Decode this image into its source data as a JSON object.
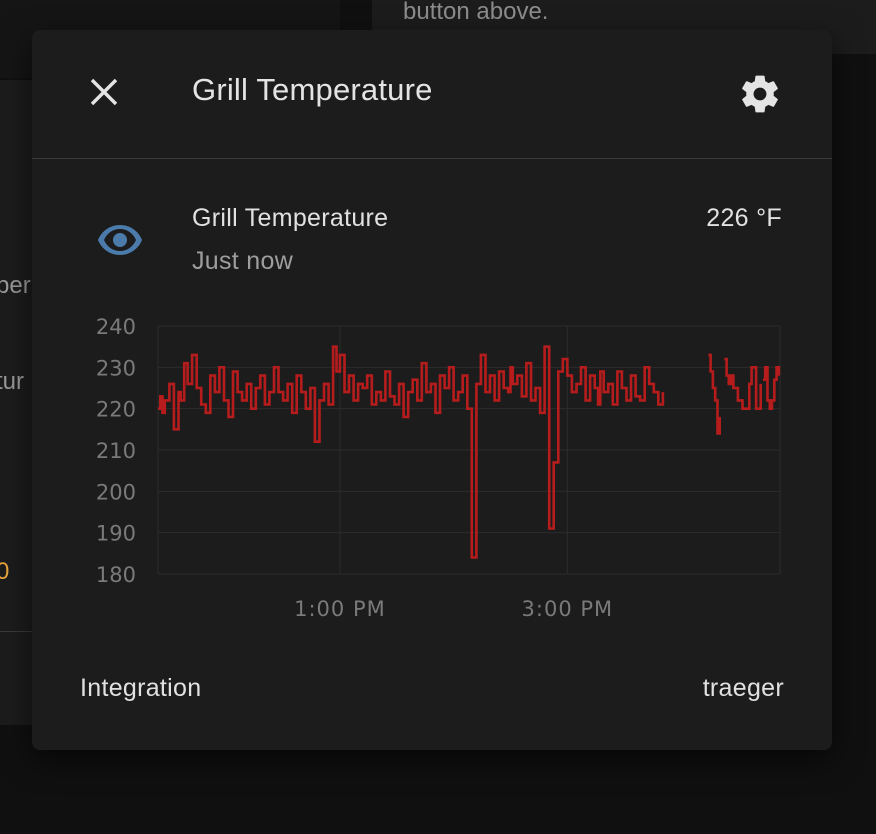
{
  "background": {
    "top_text": "button above.",
    "left_fragments": [
      "per",
      "tur",
      "0"
    ]
  },
  "dialog": {
    "title": "Grill Temperature",
    "close_icon": "close-icon",
    "settings_icon": "gear-icon"
  },
  "entity": {
    "icon": "eye-icon",
    "icon_color": "#4b7bab",
    "name": "Grill Temperature",
    "last_changed": "Just now",
    "state": "226 °F"
  },
  "attributes": {
    "integration_label": "Integration",
    "integration_value": "traeger"
  },
  "chart_data": {
    "type": "line",
    "series_color": "#b71c1c",
    "ylim": [
      180,
      240
    ],
    "y_ticks": [
      240,
      230,
      220,
      210,
      200,
      190,
      180
    ],
    "x_tick_labels": [
      "1:00 PM",
      "3:00 PM"
    ],
    "x_tick_hours": [
      13,
      15
    ],
    "xlim_hours": [
      11.4,
      16.87
    ],
    "grid": true,
    "series": [
      {
        "x_hours": [
          11.4,
          11.42,
          11.44,
          11.46,
          11.5,
          11.54,
          11.58,
          11.6,
          11.63,
          11.66,
          11.7,
          11.74,
          11.78,
          11.82,
          11.86,
          11.9,
          11.94,
          11.98,
          12.02,
          12.06,
          12.1,
          12.14,
          12.18,
          12.22,
          12.26,
          12.3,
          12.34,
          12.38,
          12.42,
          12.46,
          12.5,
          12.54,
          12.58,
          12.62,
          12.66,
          12.7,
          12.74,
          12.78,
          12.82,
          12.86,
          12.9,
          12.94,
          12.97,
          13.0,
          13.04,
          13.08,
          13.12,
          13.16,
          13.2,
          13.24,
          13.28,
          13.32,
          13.36,
          13.4,
          13.44,
          13.48,
          13.52,
          13.56,
          13.6,
          13.64,
          13.68,
          13.72,
          13.76,
          13.8,
          13.84,
          13.88,
          13.92,
          13.96,
          14.0,
          14.04,
          14.08,
          14.12,
          14.16,
          14.2,
          14.24,
          14.28,
          14.32,
          14.36,
          14.4,
          14.44,
          14.48,
          14.5,
          14.52,
          14.56,
          14.6,
          14.64,
          14.68,
          14.72,
          14.76,
          14.8,
          14.84,
          14.88,
          14.92,
          14.96,
          15.0,
          15.04,
          15.08,
          15.12,
          15.16,
          15.2,
          15.24,
          15.27,
          15.29,
          15.32,
          15.36,
          15.4,
          15.44,
          15.48,
          15.52,
          15.56,
          15.6,
          15.64,
          15.68,
          15.72,
          15.76,
          15.8,
          15.84
        ],
        "y": [
          220,
          223,
          219,
          222,
          226,
          215,
          224,
          222,
          231,
          226,
          233,
          225,
          221,
          219,
          228,
          224,
          230,
          222,
          218,
          229,
          224,
          222,
          226,
          220,
          225,
          228,
          221,
          224,
          230,
          224,
          222,
          226,
          219,
          228,
          224,
          220,
          225,
          212,
          222,
          226,
          221,
          235,
          229,
          233,
          224,
          228,
          222,
          226,
          225,
          228,
          221,
          224,
          222,
          229,
          223,
          221,
          226,
          218,
          224,
          227,
          222,
          231,
          224,
          226,
          219,
          228,
          225,
          230,
          222,
          224,
          228,
          220,
          184,
          226,
          233,
          224,
          228,
          222,
          229,
          225,
          224,
          230,
          226,
          228,
          223,
          231,
          222,
          225,
          219,
          235,
          191,
          207,
          229,
          232,
          228,
          224,
          226,
          230,
          222,
          228,
          225,
          221,
          229,
          224,
          226,
          221,
          229,
          225,
          222,
          228,
          223,
          222,
          230,
          226,
          224,
          221,
          224
        ]
      },
      {
        "x_hours": [
          16.24,
          16.26,
          16.28,
          16.3,
          16.32,
          16.34
        ],
        "y": [
          233,
          229,
          225,
          222,
          214,
          218
        ]
      },
      {
        "x_hours": [
          16.38,
          16.4,
          16.42,
          16.44,
          16.46,
          16.5,
          16.54,
          16.58,
          16.6,
          16.62,
          16.66,
          16.7
        ],
        "y": [
          232,
          228,
          226,
          228,
          225,
          222,
          220,
          220,
          226,
          230,
          220,
          226
        ]
      },
      {
        "x_hours": [
          16.72,
          16.74,
          16.76,
          16.78,
          16.8,
          16.82,
          16.84,
          16.86
        ],
        "y": [
          227,
          230,
          222,
          220,
          222,
          227,
          230,
          228
        ]
      }
    ]
  }
}
